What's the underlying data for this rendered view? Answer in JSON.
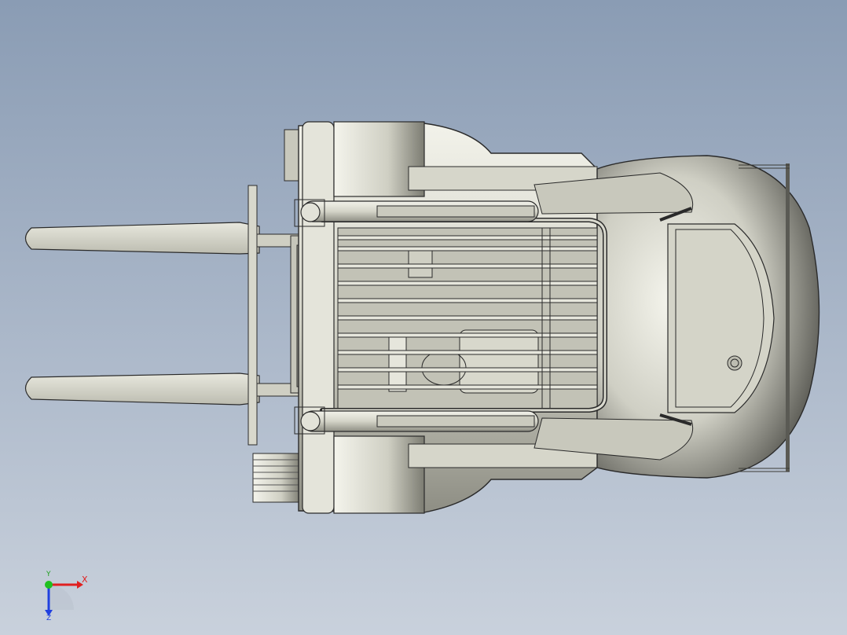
{
  "triad": {
    "x_label": "X",
    "y_label": "Y",
    "z_label": "Z",
    "x_color": "#e02020",
    "y_color": "#20c020",
    "z_color": "#2040e0"
  },
  "model": {
    "body_color": "#d9d9ce",
    "edge_color": "#2a2a2a",
    "shade_color": "#9a9a90"
  }
}
